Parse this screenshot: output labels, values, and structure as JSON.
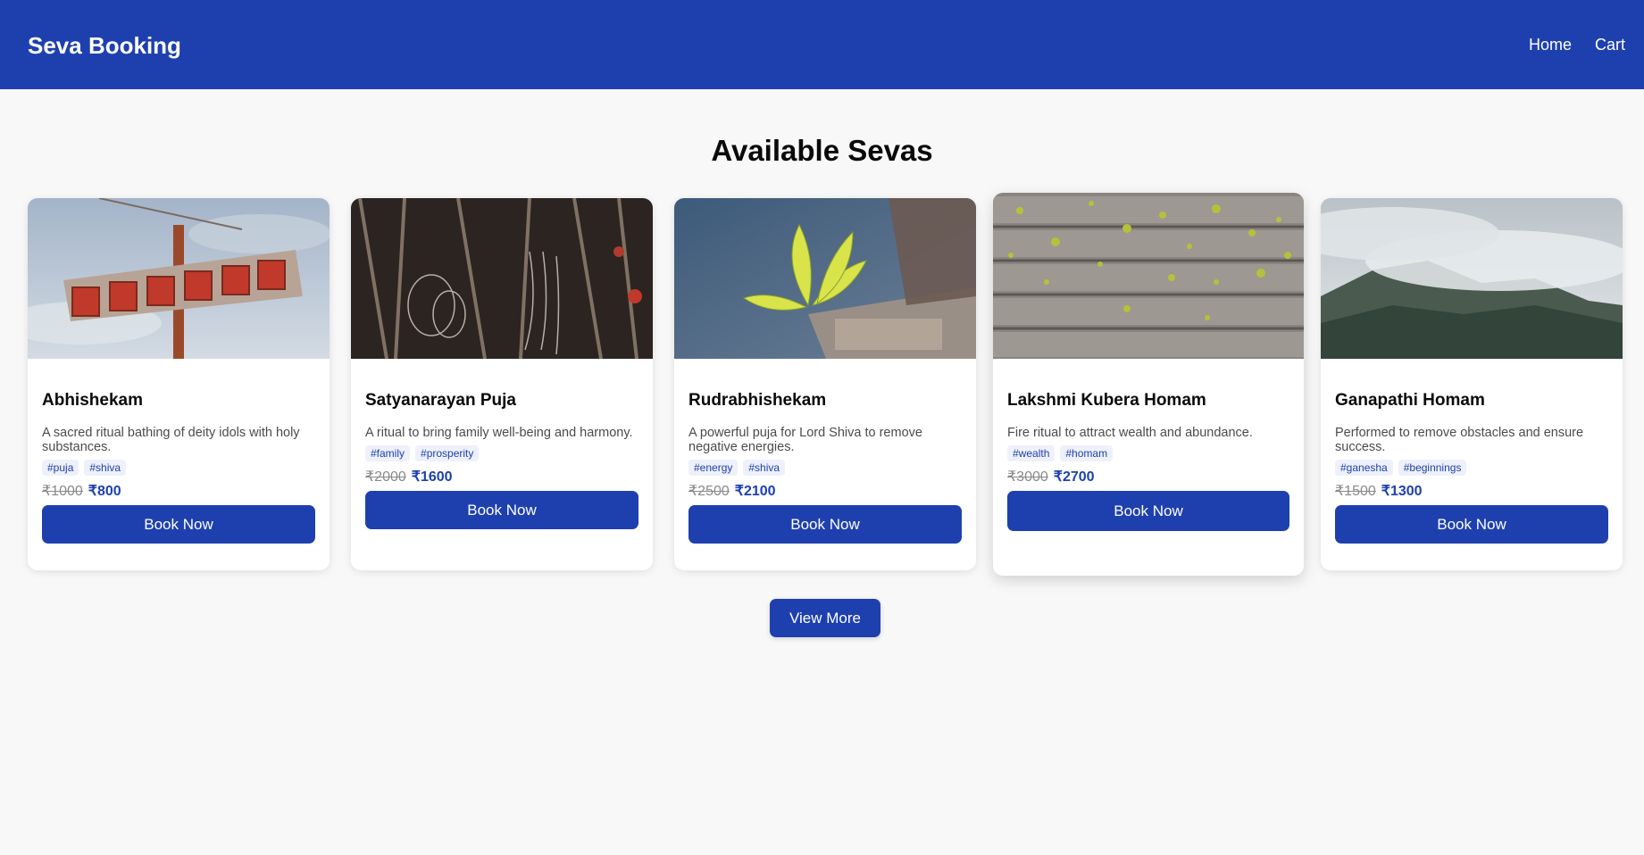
{
  "header": {
    "brand": "Seva Booking",
    "nav": [
      {
        "label": "Home"
      },
      {
        "label": "Cart"
      }
    ]
  },
  "main": {
    "title": "Available Sevas",
    "view_more_label": "View More",
    "cards": [
      {
        "title": "Abhishekam",
        "description": "A sacred ritual bathing of deity idols with holy substances.",
        "tags": [
          "#puja",
          "#shiva"
        ],
        "old_price": "₹1000",
        "price": "₹800",
        "button_label": "Book Now",
        "image": "motel-sign-photo"
      },
      {
        "title": "Satyanarayan Puja",
        "description": "A ritual to bring family well-being and harmony.",
        "tags": [
          "#family",
          "#prosperity"
        ],
        "old_price": "₹2000",
        "price": "₹1600",
        "button_label": "Book Now",
        "image": "hanging-objects-photo"
      },
      {
        "title": "Rudrabhishekam",
        "description": "A powerful puja for Lord Shiva to remove negative energies.",
        "tags": [
          "#energy",
          "#shiva"
        ],
        "old_price": "₹2500",
        "price": "₹2100",
        "button_label": "Book Now",
        "image": "plant-on-rock-photo"
      },
      {
        "title": "Lakshmi Kubera Homam",
        "description": "Fire ritual to attract wealth and abundance.",
        "tags": [
          "#wealth",
          "#homam"
        ],
        "old_price": "₹3000",
        "price": "₹2700",
        "button_label": "Book Now",
        "image": "wooden-deck-leaves-photo"
      },
      {
        "title": "Ganapathi Homam",
        "description": "Performed to remove obstacles and ensure success.",
        "tags": [
          "#ganesha",
          "#beginnings"
        ],
        "old_price": "₹1500",
        "price": "₹1300",
        "button_label": "Book Now",
        "image": "misty-mountain-photo"
      }
    ]
  },
  "colors": {
    "primary": "#1e40af",
    "background": "#f8f8f8",
    "card": "#ffffff",
    "tag_bg": "#eef1fb",
    "muted_price": "#8a8a8a"
  }
}
